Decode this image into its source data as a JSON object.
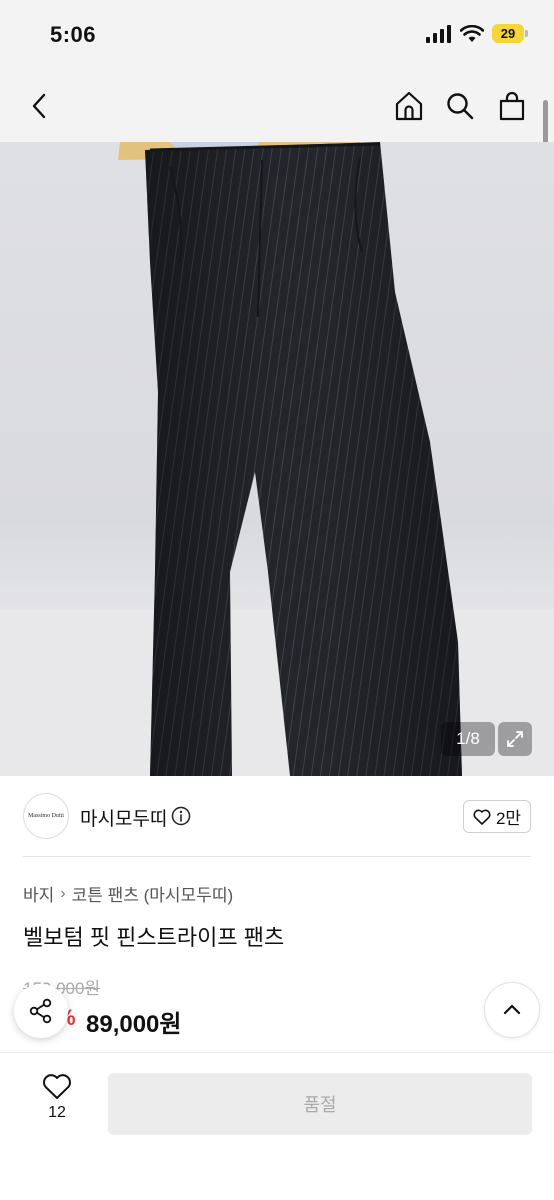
{
  "status_bar": {
    "time": "5:06",
    "battery": "29"
  },
  "nav": {
    "back_icon": "chevron-left-icon",
    "home_icon": "home-icon",
    "search_icon": "search-icon",
    "bag_icon": "shopping-bag-icon"
  },
  "gallery": {
    "counter": "1/8",
    "expand_icon": "expand-icon"
  },
  "brand": {
    "logo_text": "Massimo Dutti",
    "name": "마시모두띠",
    "like_count": "2만"
  },
  "product": {
    "breadcrumb": [
      "바지",
      "코튼 팬츠 (마시모두띠)"
    ],
    "title": "벨보텀 핏 핀스트라이프 팬츠",
    "original_price": "159,000원",
    "discount": "%",
    "sale_price": "89,000원"
  },
  "bottom_bar": {
    "wish_count": "12",
    "soldout_label": "품절"
  },
  "colors": {
    "accent_red": "#e33333",
    "soldout_bg": "#ececec",
    "battery": "#f5d638"
  }
}
